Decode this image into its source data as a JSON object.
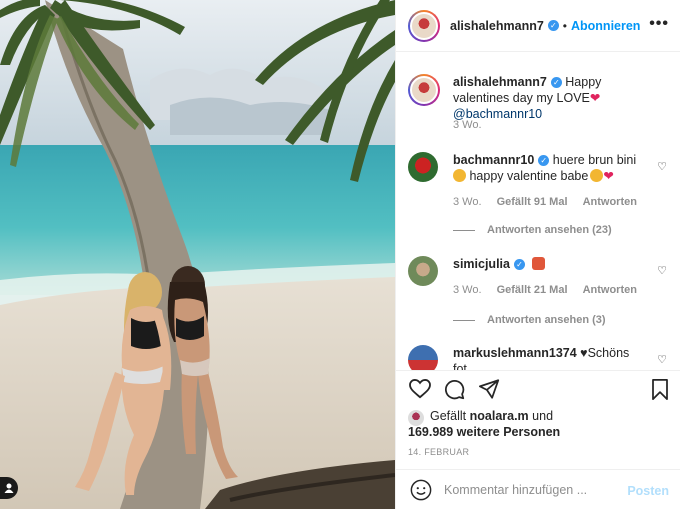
{
  "post": {
    "username": "alishalehmann7",
    "verified_glyph": "✓",
    "follow_sep": "•",
    "follow_label": "Abonnieren",
    "more_glyph": "•••"
  },
  "caption": {
    "username": "alishalehmann7",
    "text": "Happy valentines day my LOVE",
    "mention": "@bachmannr10",
    "time": "3 Wo."
  },
  "comments": [
    {
      "username": "bachmannr10",
      "text": "huere brun bini",
      "text2": "happy valentine babe",
      "time": "3 Wo.",
      "likes": "Gefällt 91 Mal",
      "reply": "Antworten",
      "view_replies": "Antworten ansehen (23)"
    },
    {
      "username": "simicjulia",
      "time": "3 Wo.",
      "likes": "Gefällt 21 Mal",
      "reply": "Antworten",
      "view_replies": "Antworten ansehen (3)"
    },
    {
      "username": "markuslehmann1374",
      "text": "Schöns",
      "text2": "fot"
    }
  ],
  "likes": {
    "prefix": "Gefällt",
    "user": "noalara.m",
    "suffix": "und",
    "count_line": "169.989 weitere Personen"
  },
  "date": "14. FEBRUAR",
  "add_comment": {
    "placeholder": "Kommentar hinzufügen ...",
    "post_label": "Posten"
  },
  "icons": {
    "heart": "heart-icon",
    "comment": "comment-icon",
    "share": "share-icon",
    "save": "bookmark-icon",
    "emoji": "smiley-icon",
    "user": "user-icon"
  },
  "colors": {
    "accent": "#0095f6",
    "verified": "#3897f0",
    "meta": "#8e8e8e",
    "heart_red": "#e0245e",
    "post_disabled": "#b2dffc"
  }
}
